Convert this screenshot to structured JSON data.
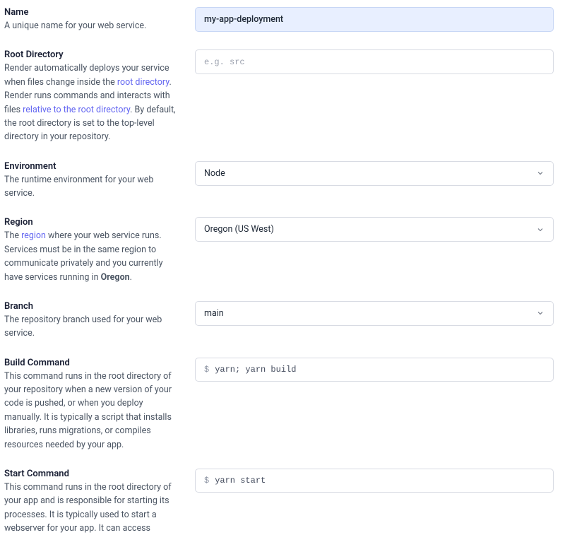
{
  "name": {
    "label": "Name",
    "desc_full": "A unique name for your web service.",
    "value": "my-app-deployment"
  },
  "rootDirectory": {
    "label": "Root Directory",
    "desc_pre": "Render automatically deploys your service when files change inside the ",
    "link1": "root directory",
    "desc_mid": ". Render runs commands and interacts with files ",
    "link2": "relative to the root directory",
    "desc_post": ". By default, the root directory is set to the top-level directory in your repository.",
    "placeholder": "e.g. src"
  },
  "environment": {
    "label": "Environment",
    "desc": "The runtime environment for your web service.",
    "value": "Node"
  },
  "region": {
    "label": "Region",
    "desc_pre": "The ",
    "link1": "region",
    "desc_mid": " where your web service runs. Services must be in the same region to communicate privately and you currently have services running in ",
    "bold": "Oregon",
    "desc_post": ".",
    "value": "Oregon (US West)"
  },
  "branch": {
    "label": "Branch",
    "desc": "The repository branch used for your web service.",
    "value": "main"
  },
  "buildCommand": {
    "label": "Build Command",
    "desc": "This command runs in the root directory of your repository when a new version of your code is pushed, or when you deploy manually. It is typically a script that installs libraries, runs migrations, or compiles resources needed by your app.",
    "prompt": "$",
    "value": "yarn; yarn build"
  },
  "startCommand": {
    "label": "Start Command",
    "desc": "This command runs in the root directory of your app and is responsible for starting its processes. It is typically used to start a webserver for your app. It can access",
    "prompt": "$",
    "value": "yarn start"
  }
}
